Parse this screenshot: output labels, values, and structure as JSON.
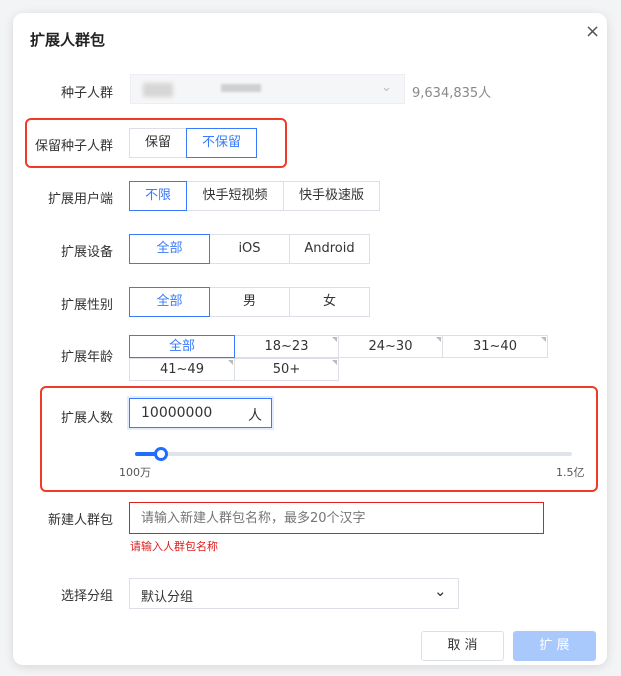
{
  "dialog": {
    "title": "扩展人群包",
    "close": "×"
  },
  "seed": {
    "label": "种子人群",
    "count": "9,634,835人"
  },
  "retain": {
    "label": "保留种子人群",
    "options": [
      "保留",
      "不保留"
    ],
    "selected": "不保留"
  },
  "client": {
    "label": "扩展用户端",
    "options": [
      "不限",
      "快手短视频",
      "快手极速版"
    ],
    "selected": "不限"
  },
  "device": {
    "label": "扩展设备",
    "options": [
      "全部",
      "iOS",
      "Android"
    ],
    "selected": "全部"
  },
  "gender": {
    "label": "扩展性别",
    "options": [
      "全部",
      "男",
      "女"
    ],
    "selected": "全部"
  },
  "age": {
    "label": "扩展年龄",
    "options": [
      "全部",
      "18~23",
      "24~30",
      "31~40",
      "41~49",
      "50+"
    ],
    "selected": "全部"
  },
  "size": {
    "label": "扩展人数",
    "value": "10000000",
    "unit": "人",
    "slider_min_label": "100万",
    "slider_max_label": "1.5亿",
    "slider_min": 1000000,
    "slider_max": 150000000,
    "slider_value": 10000000
  },
  "name": {
    "label": "新建人群包",
    "placeholder": "请输入新建人群包名称，最多20个汉字",
    "error": "请输入人群包名称"
  },
  "group": {
    "label": "选择分组",
    "value": "默认分组"
  },
  "footer": {
    "cancel": "取 消",
    "confirm": "扩 展"
  },
  "colors": {
    "accent": "#3a7afe",
    "error": "#e02020",
    "highlight": "#f03a2a"
  }
}
